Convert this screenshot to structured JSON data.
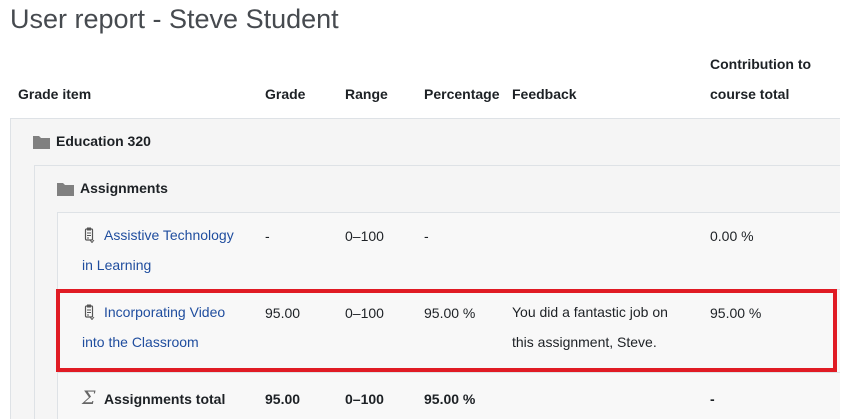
{
  "page": {
    "title": "User report - Steve Student"
  },
  "columns": {
    "grade_item": "Grade item",
    "grade": "Grade",
    "range": "Range",
    "percentage": "Percentage",
    "feedback": "Feedback",
    "contribution_line1": "Contribution to",
    "contribution_line2": "course total"
  },
  "rows": {
    "course": {
      "icon": "folder-icon",
      "name": "Education 320"
    },
    "category": {
      "icon": "folder-icon",
      "name": "Assignments"
    },
    "items": [
      {
        "icon": "assignment-icon",
        "name_line1": "Assistive Technology",
        "name_line2": "in Learning",
        "grade": "-",
        "range": "0–100",
        "percentage": "-",
        "feedback_line1": "",
        "feedback_line2": "",
        "contribution": "0.00 %"
      },
      {
        "icon": "assignment-icon",
        "name_line1": "Incorporating Video",
        "name_line2": "into the Classroom",
        "grade": "95.00",
        "range": "0–100",
        "percentage": "95.00 %",
        "feedback_line1": "You did a fantastic job on",
        "feedback_line2": "this assignment, Steve.",
        "contribution": "95.00 %"
      }
    ],
    "total": {
      "icon": "sigma-icon",
      "name": "Assignments total",
      "grade": "95.00",
      "range": "0–100",
      "percentage": "95.00 %",
      "contribution": "-"
    }
  },
  "colors": {
    "highlight": "#e01b24",
    "link": "#1f4d9e",
    "row_shade": "#f5f5f5"
  }
}
